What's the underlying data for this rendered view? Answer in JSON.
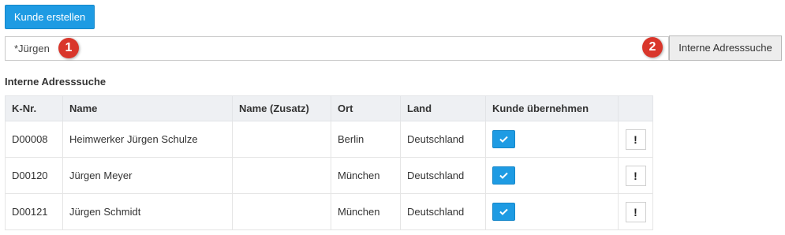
{
  "toolbar": {
    "create_customer_label": "Kunde erstellen"
  },
  "search": {
    "value": "*Jürgen",
    "button_label": "Interne Adresssuche",
    "markers": [
      "1",
      "2"
    ]
  },
  "results": {
    "section_title": "Interne Adresssuche",
    "columns": [
      "K-Nr.",
      "Name",
      "Name (Zusatz)",
      "Ort",
      "Land",
      "Kunde übernehmen",
      ""
    ],
    "rows": [
      {
        "knr": "D00008",
        "name": "Heimwerker Jürgen Schulze",
        "name_zusatz": "",
        "ort": "Berlin",
        "land": "Deutschland"
      },
      {
        "knr": "D00120",
        "name": "Jürgen Meyer",
        "name_zusatz": "",
        "ort": "München",
        "land": "Deutschland"
      },
      {
        "knr": "D00121",
        "name": "Jürgen Schmidt",
        "name_zusatz": "",
        "ort": "München",
        "land": "Deutschland"
      }
    ],
    "detail_button_label": "!"
  },
  "icons": {
    "accept": "check-icon"
  },
  "colors": {
    "accent": "#1e9be3",
    "marker": "#d9362b",
    "header_bg": "#eef0f3"
  }
}
